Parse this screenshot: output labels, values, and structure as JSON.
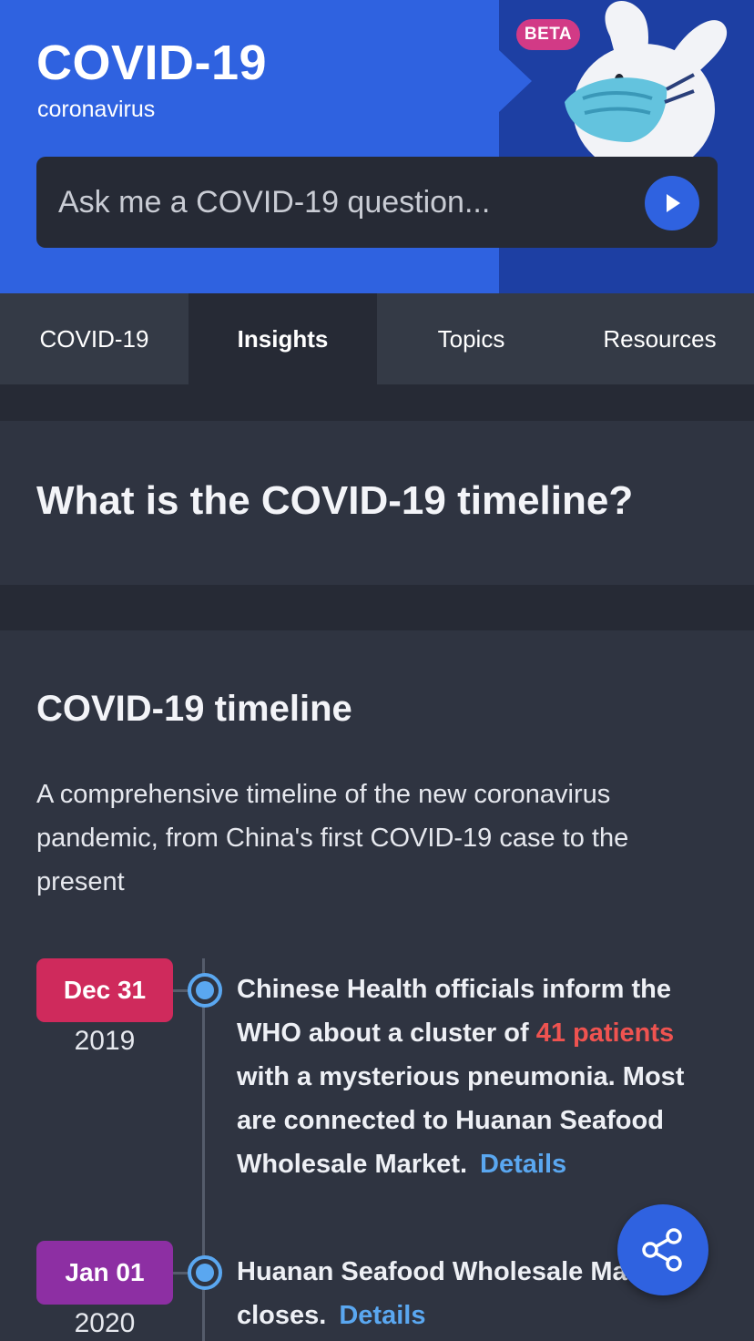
{
  "header": {
    "title": "COVID-19",
    "subtitle": "coronavirus",
    "badge": "BETA",
    "colors": {
      "primary": "#2f62e0",
      "dark_blue": "#1d3fa3",
      "badge": "#d23a86"
    }
  },
  "search": {
    "placeholder": "Ask me a COVID-19 question...",
    "value": "",
    "submit_icon": "play-icon"
  },
  "tabs": [
    {
      "label": "COVID-19",
      "active": false
    },
    {
      "label": "Insights",
      "active": true
    },
    {
      "label": "Topics",
      "active": false
    },
    {
      "label": "Resources",
      "active": false
    }
  ],
  "question": {
    "title": "What is the COVID-19 timeline?"
  },
  "timeline": {
    "title": "COVID-19 timeline",
    "description": "A comprehensive timeline of the new coronavirus pandemic, from China's first COVID-19 case to the present",
    "events": [
      {
        "date": "Dec 31",
        "year": "2019",
        "pill_color": "#cf2a5c",
        "text_before": "Chinese Health officials inform the WHO about a cluster of ",
        "highlight": "41 patients",
        "text_after": " with a mysterious pneumonia. Most are connected to Huanan Seafood Wholesale Market.",
        "link": "Details"
      },
      {
        "date": "Jan 01",
        "year": "2020",
        "pill_color": "#8d2fa3",
        "text_before": "Huanan Seafood Wholesale Market closes.",
        "highlight": "",
        "text_after": "",
        "link": "Details"
      }
    ]
  },
  "share": {
    "icon": "share-icon"
  }
}
